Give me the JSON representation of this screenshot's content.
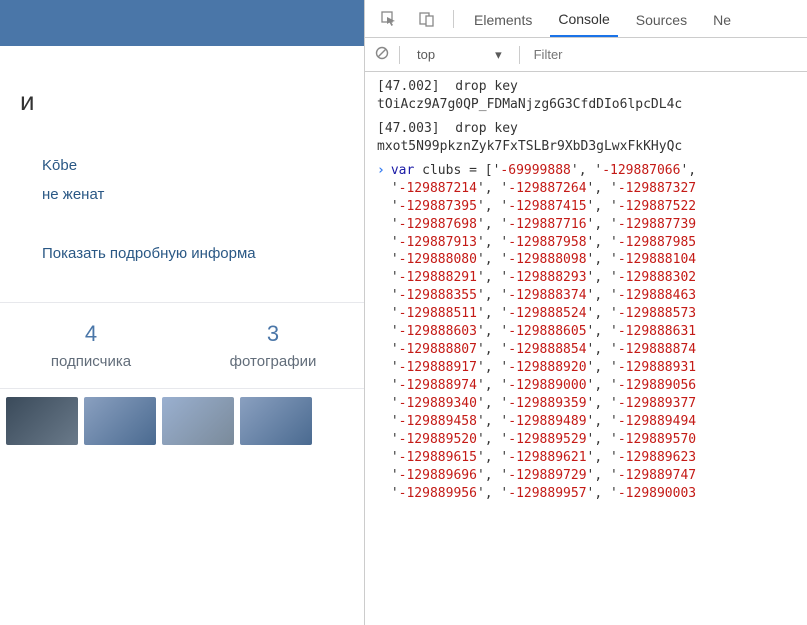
{
  "left": {
    "header_fragment": "и",
    "city": "Kōbe",
    "marital": "не женат",
    "details_link": "Показать подробную информа",
    "stats": [
      {
        "num": "4",
        "label": "подписчика"
      },
      {
        "num": "3",
        "label": "фотографии"
      }
    ]
  },
  "devtools": {
    "tabs": {
      "elements": "Elements",
      "console": "Console",
      "sources": "Sources",
      "network": "Ne"
    },
    "toolbar": {
      "context": "top",
      "filter_placeholder": "Filter"
    },
    "log1": "[47.002]  drop key\ntOiAcz9A7g0QP_FDMaNjzg6G3CfdDIo6lpcDL4c",
    "log2": "[47.003]  drop key\nmxot5N99pkznZyk7FxTSLBr9XbD3gLwxFkKHyQc",
    "code": {
      "keyword": "var",
      "varname": "clubs",
      "clubs_rows": [
        [
          "'-69999888'",
          "'-129887066'",
          ""
        ],
        [
          "'-129887214'",
          "'-129887264'",
          "'-129887327"
        ],
        [
          "'-129887395'",
          "'-129887415'",
          "'-129887522"
        ],
        [
          "'-129887698'",
          "'-129887716'",
          "'-129887739"
        ],
        [
          "'-129887913'",
          "'-129887958'",
          "'-129887985"
        ],
        [
          "'-129888080'",
          "'-129888098'",
          "'-129888104"
        ],
        [
          "'-129888291'",
          "'-129888293'",
          "'-129888302"
        ],
        [
          "'-129888355'",
          "'-129888374'",
          "'-129888463"
        ],
        [
          "'-129888511'",
          "'-129888524'",
          "'-129888573"
        ],
        [
          "'-129888603'",
          "'-129888605'",
          "'-129888631"
        ],
        [
          "'-129888807'",
          "'-129888854'",
          "'-129888874"
        ],
        [
          "'-129888917'",
          "'-129888920'",
          "'-129888931"
        ],
        [
          "'-129888974'",
          "'-129889000'",
          "'-129889056"
        ],
        [
          "'-129889340'",
          "'-129889359'",
          "'-129889377"
        ],
        [
          "'-129889458'",
          "'-129889489'",
          "'-129889494"
        ],
        [
          "'-129889520'",
          "'-129889529'",
          "'-129889570"
        ],
        [
          "'-129889615'",
          "'-129889621'",
          "'-129889623"
        ],
        [
          "'-129889696'",
          "'-129889729'",
          "'-129889747"
        ],
        [
          "'-129889956'",
          "'-129889957'",
          "'-129890003"
        ]
      ]
    }
  }
}
